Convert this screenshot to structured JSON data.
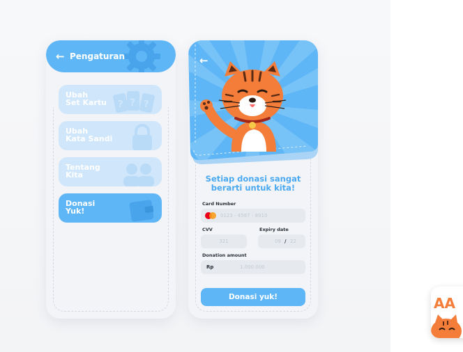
{
  "settings_screen": {
    "back_icon": "arrow-left-icon",
    "title": "Pengaturan",
    "header_icon": "gear-icon",
    "menu": [
      {
        "label": "Ubah\nSet Kartu",
        "icon": "cards-icon"
      },
      {
        "label": "Ubah\nKata Sandi",
        "icon": "lock-icon"
      },
      {
        "label": "Tentang\nKita",
        "icon": "people-icon"
      },
      {
        "label": "Donasi\nYuk!",
        "icon": "wallet-icon",
        "active": true
      }
    ]
  },
  "donation_screen": {
    "back_icon": "arrow-left-icon",
    "illustration": "waving-cat-icon",
    "heading": "Setiap donasi sangat berarti untuk kita!",
    "card_number": {
      "label": "Card Number",
      "placeholder": "0123 - 4567 - 8910",
      "brand_icon": "mastercard-icon"
    },
    "cvv": {
      "label": "CVV",
      "placeholder": "321"
    },
    "expiry": {
      "label": "Expiry date",
      "month": "09",
      "separator": "/",
      "year": "22"
    },
    "amount": {
      "label": "Donation amount",
      "currency": "Rp",
      "placeholder": "1.000.000"
    },
    "submit_label": "Donasi yuk!"
  },
  "app_icon": {
    "name": "app-logo-icon",
    "letters": "AA"
  },
  "colors": {
    "primary": "#5fb6f6",
    "primary_light": "#cfe6fb",
    "heading": "#4aa9f0",
    "card_bg": "#f2f4f7",
    "cat_orange": "#f47d3a"
  }
}
